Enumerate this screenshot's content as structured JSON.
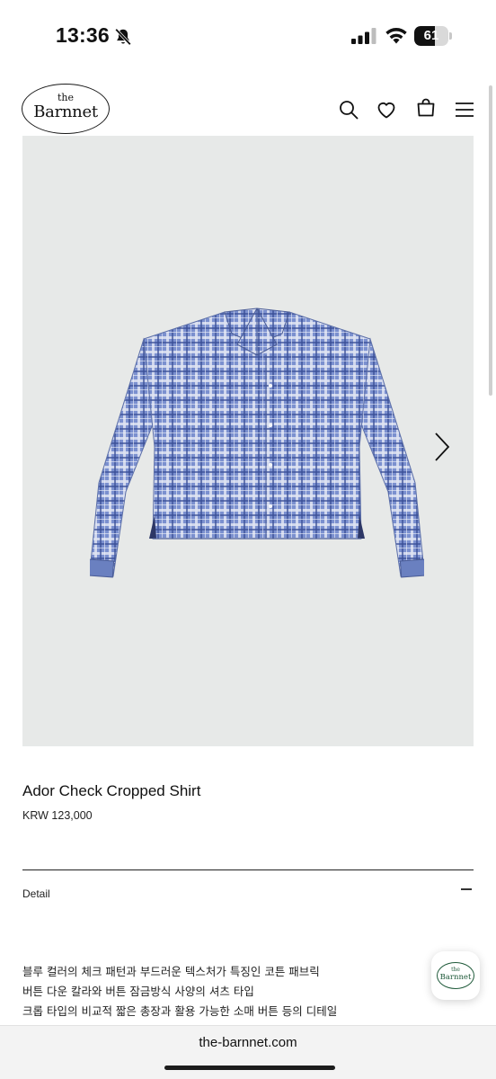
{
  "status_bar": {
    "time": "13:36",
    "battery_percent": 61,
    "battery_label": "61",
    "icons": [
      "bell-slash-icon",
      "cellular-signal-icon",
      "wifi-icon",
      "battery-icon"
    ]
  },
  "header": {
    "logo_the": "the",
    "logo_name": "Barnnet",
    "icons": [
      "search-icon",
      "heart-icon",
      "shopping-bag-icon",
      "hamburger-menu-icon"
    ]
  },
  "product": {
    "name": "Ador Check Cropped Shirt",
    "price": "KRW 123,000",
    "image_icon": "chevron-right-icon"
  },
  "detail": {
    "label": "Detail",
    "toggle_icon": "minus-icon",
    "description": [
      "블루 컬러의 체크 패턴과 부드러운 텍스처가 특징인 코튼 패브릭",
      "버튼 다운 칼라와 버튼 잠금방식 사양의 셔츠 타입",
      "크롭 타입의 비교적 짧은 총장과 활용 가능한 소매 버튼 등의 디테일"
    ]
  },
  "floating_badge": {
    "logo_the": "the",
    "logo_name": "Barnnet"
  },
  "browser": {
    "url": "the-barnnet.com"
  },
  "colors": {
    "image_background": "#e7e9e8",
    "shirt_blue": "#6f86c4",
    "logo_green": "#1f5a3a"
  }
}
